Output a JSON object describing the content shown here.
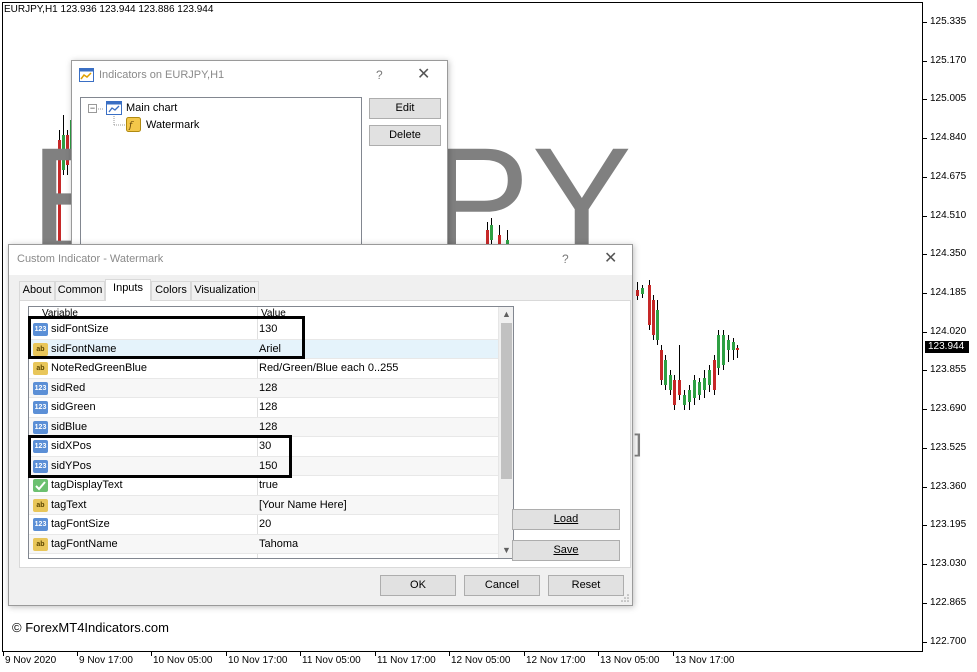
{
  "chart": {
    "symbol_info": "EURJPY,H1  123.936 123.944 123.886 123.944",
    "watermark_text": "EURJPY",
    "tag_text_visible": "ere]",
    "copyright": "© ForexMT4Indicators.com",
    "current_price": "123.944",
    "price_ticks": [
      "125.335",
      "125.170",
      "125.005",
      "124.840",
      "124.675",
      "124.510",
      "124.350",
      "124.185",
      "124.020",
      "123.855",
      "123.690",
      "123.525",
      "123.360",
      "123.195",
      "123.030",
      "122.865",
      "122.700"
    ],
    "time_ticks": [
      "9 Nov 2020",
      "9 Nov 17:00",
      "10 Nov 05:00",
      "10 Nov 17:00",
      "11 Nov 05:00",
      "11 Nov 17:00",
      "12 Nov 05:00",
      "12 Nov 17:00",
      "13 Nov 05:00",
      "13 Nov 17:00"
    ],
    "colors": {
      "bull": "#2ea043",
      "bear": "#c62828",
      "watermark": "#808080"
    }
  },
  "indicators_dialog": {
    "title": "Indicators on EURJPY,H1",
    "help": "?",
    "close": "✕",
    "tree": {
      "root": "Main chart",
      "child": "Watermark"
    },
    "edit_label": "Edit",
    "delete_label": "Delete"
  },
  "custom_dialog": {
    "title": "Custom Indicator - Watermark",
    "help": "?",
    "close": "✕",
    "tabs": [
      "About",
      "Common",
      "Inputs",
      "Colors",
      "Visualization"
    ],
    "active_tab": "Inputs",
    "columns": {
      "variable": "Variable",
      "value": "Value"
    },
    "rows": [
      {
        "type": "123",
        "name": "sidFontSize",
        "value": "130"
      },
      {
        "type": "ab",
        "name": "sidFontName",
        "value": "Ariel"
      },
      {
        "type": "ab",
        "name": "NoteRedGreenBlue",
        "value": "Red/Green/Blue each 0..255"
      },
      {
        "type": "123",
        "name": "sidRed",
        "value": "128"
      },
      {
        "type": "123",
        "name": "sidGreen",
        "value": "128"
      },
      {
        "type": "123",
        "name": "sidBlue",
        "value": "128"
      },
      {
        "type": "123",
        "name": "sidXPos",
        "value": "30"
      },
      {
        "type": "123",
        "name": "sidYPos",
        "value": "150"
      },
      {
        "type": "bool",
        "name": "tagDisplayText",
        "value": "true"
      },
      {
        "type": "ab",
        "name": "tagText",
        "value": "[Your Name Here]"
      },
      {
        "type": "123",
        "name": "tagFontSize",
        "value": "20"
      },
      {
        "type": "ab",
        "name": "tagFontName",
        "value": "Tahoma"
      }
    ],
    "load_label": "Load",
    "save_label": "Save",
    "ok_label": "OK",
    "cancel_label": "Cancel",
    "reset_label": "Reset"
  }
}
